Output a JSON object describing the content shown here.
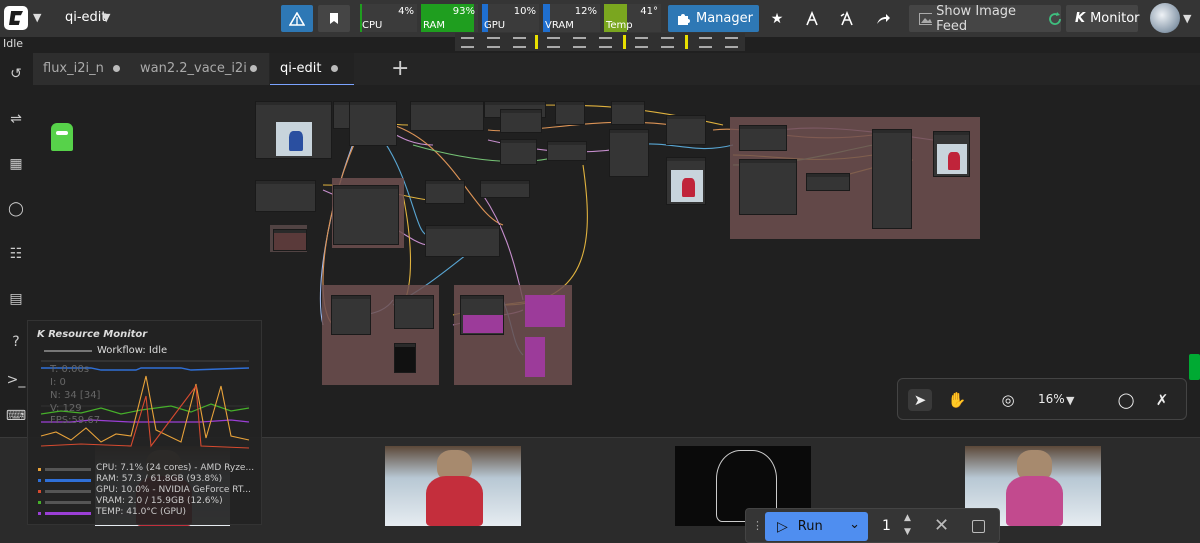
{
  "workflow": {
    "name": "qi-edit",
    "status": "Idle"
  },
  "meters": [
    {
      "label": "CPU",
      "percent": "4%",
      "value": 0.04,
      "color": "#1f9e1f"
    },
    {
      "label": "RAM",
      "percent": "93%",
      "value": 0.93,
      "color": "#1f9e1f"
    },
    {
      "label": "GPU",
      "percent": "10%",
      "value": 0.1,
      "color": "#1f6fd0"
    },
    {
      "label": "VRAM",
      "percent": "12%",
      "value": 0.12,
      "color": "#1f6fd0"
    },
    {
      "label": "Temp",
      "percent": "41°",
      "value": 0.41,
      "color": "#7aa61f"
    }
  ],
  "toolbar": {
    "manager_label": "Manager",
    "show_image_feed_label": "Show Image Feed",
    "monitor_label": "Monitor",
    "monitor_prefix": "K"
  },
  "tabs": [
    {
      "label": "flux_i2i_n"
    },
    {
      "label": "wan2.2_vace_i2i"
    },
    {
      "label": "qi-edit"
    }
  ],
  "sidebar": {
    "items": [
      "history-icon",
      "model-library-icon",
      "node-library-icon",
      "workflows-icon",
      "templates-icon",
      "queue-icon",
      "help-icon",
      "terminal-icon",
      "keyboard-icon"
    ]
  },
  "canvas_controls": {
    "zoom": "16%"
  },
  "resource_monitor": {
    "title": "Resource Monitor",
    "title_prefix": "K",
    "workflow_status": "Workflow: Idle",
    "stats": [
      "T: 0.00s",
      "I: 0",
      "N: 34 [34]",
      "V: 129",
      "FPS:59.67"
    ],
    "legend": [
      {
        "text": "CPU: 7.1% (24 cores) - AMD Ryze...",
        "color": "#e8a23a"
      },
      {
        "text": "RAM: 57.3 / 61.8GB (93.8%)",
        "color": "#2f6fd6"
      },
      {
        "text": "GPU: 10.0% - NVIDIA GeForce RT...",
        "color": "#d64a2f"
      },
      {
        "text": "VRAM: 2.0 / 15.9GB (12.6%)",
        "color": "#46b02a"
      },
      {
        "text": "TEMP: 41.0°C (GPU)",
        "color": "#9b3fd6"
      }
    ]
  },
  "run_panel": {
    "run_label": "Run",
    "batch_count": "1"
  }
}
